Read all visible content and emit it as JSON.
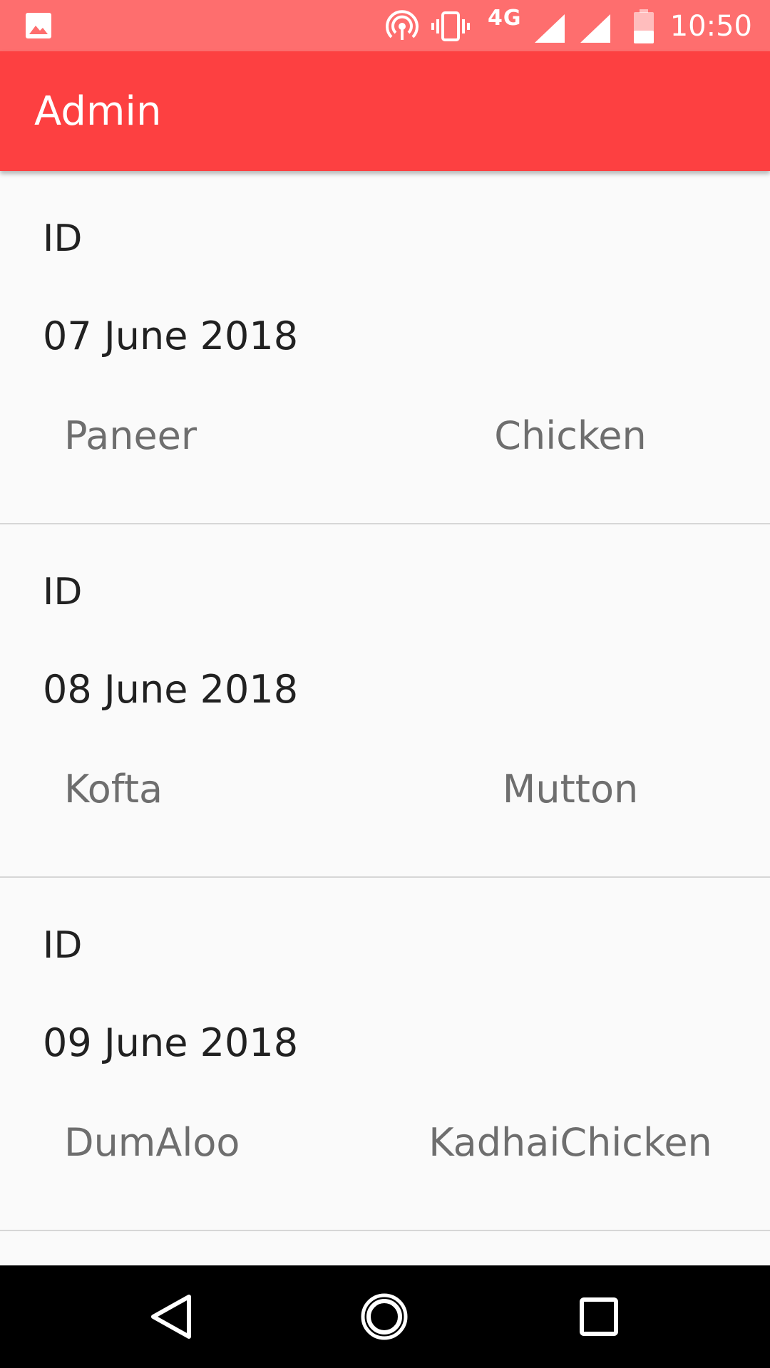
{
  "status_bar": {
    "network_type": "4G",
    "time": "10:50",
    "icons": [
      "gallery-icon",
      "hotspot-icon",
      "vibrate-icon",
      "signal-icon",
      "signal-icon",
      "battery-icon"
    ]
  },
  "app_bar": {
    "title": "Admin"
  },
  "orders": [
    {
      "id_label": "ID",
      "date": "07 June 2018",
      "item_left": "Paneer",
      "item_right": "Chicken"
    },
    {
      "id_label": "ID",
      "date": "08 June 2018",
      "item_left": "Kofta",
      "item_right": "Mutton"
    },
    {
      "id_label": "ID",
      "date": "09 June 2018",
      "item_left": "DumAloo",
      "item_right": "KadhaiChicken"
    }
  ],
  "nav_bar": {
    "icons": [
      "back-icon",
      "home-icon",
      "recents-icon"
    ]
  },
  "colors": {
    "status_bar": "#fe6e6e",
    "app_bar": "#fd4041",
    "background": "#fafafa",
    "primary_text": "#212121",
    "secondary_text": "#6e6e6e",
    "divider": "#d6d6d6"
  }
}
